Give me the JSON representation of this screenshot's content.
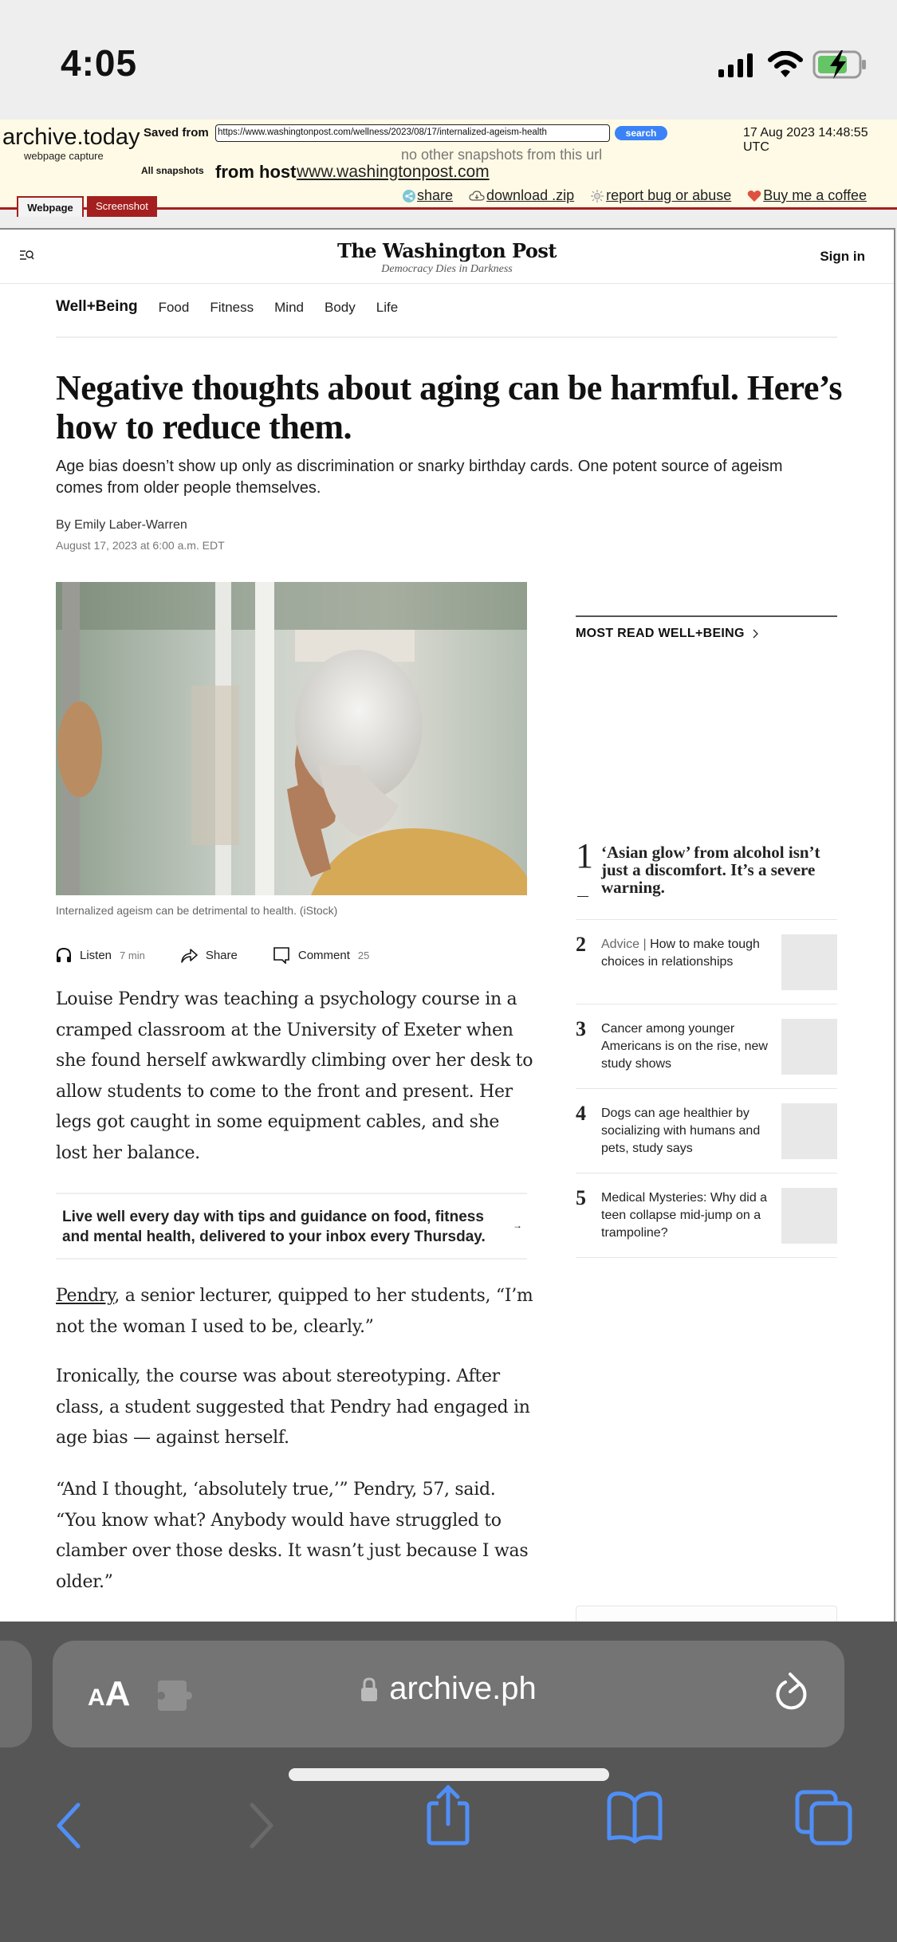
{
  "status_bar": {
    "time": "4:05",
    "icons": [
      "cellular-signal-icon",
      "wifi-icon",
      "battery-charging-icon"
    ],
    "battery_color": "#65c466"
  },
  "archive": {
    "logo": "archive.today",
    "subtitle": "webpage capture",
    "saved_from_label": "Saved from",
    "url_value": "https://www.washingtonpost.com/wellness/2023/08/17/internalized-ageism-health",
    "search_label": "search",
    "capture_date": "17 Aug 2023 14:48:55 UTC",
    "no_other": "no other snapshots from this url",
    "all_snapshots_label": "All snapshots",
    "from_host_label": "from host",
    "host": "www.washingtonpost.com",
    "tabs": [
      {
        "label": "Webpage",
        "active": true
      },
      {
        "label": "Screenshot",
        "active": false
      }
    ],
    "links": [
      {
        "icon": "share-icon",
        "label": "share"
      },
      {
        "icon": "cloud-download-icon",
        "label": "download .zip"
      },
      {
        "icon": "bug-icon",
        "label": "report bug or abuse"
      },
      {
        "icon": "heart-icon",
        "label": "Buy me a coffee"
      }
    ],
    "accent": "#a41f1f",
    "search_color": "#3b82f6"
  },
  "wp": {
    "logo": "The Washington Post",
    "tagline": "Democracy Dies in Darkness",
    "sign_in": "Sign in",
    "subnav": {
      "brand": "Well+Being",
      "items": [
        "Food",
        "Fitness",
        "Mind",
        "Body",
        "Life"
      ]
    }
  },
  "article": {
    "headline": "Negative thoughts about aging can be harmful. Here’s how to reduce them.",
    "dek": "Age bias doesn’t show up only as discrimination or snarky birthday cards. One potent source of ageism comes from older people themselves.",
    "byline": "By Emily Laber-Warren",
    "date": "August 17, 2023 at 6:00 a.m. EDT",
    "image_caption": "Internalized ageism can be detrimental to health. (iStock)",
    "actions": {
      "listen": "Listen",
      "listen_time": "7 min",
      "share": "Share",
      "comment": "Comment",
      "comment_count": "25"
    },
    "paragraphs": [
      "Louise Pendry was teaching a psychology course in a cramped classroom at the University of Exeter when she found herself awkwardly climbing over her desk to allow students to come to the front and present. Her legs got caught in some equipment cables, and she lost her balance.",
      "Ironically, the course was about stereotyping. After class, a student suggested that Pendry had engaged in age bias — against herself.",
      "“And I thought, ‘absolutely true,’” Pendry, 57, said. “You know what? Anybody would have struggled to clamber over those desks. It wasn’t just because I was older.”"
    ],
    "para2_link": "Pendry",
    "para2_rest": ", a senior lecturer, quipped to her students, “I’m not the woman I used to be, clearly.”",
    "newsletter": "Live well every day with tips and guidance on food, fitness and mental health, delivered to your inbox every Thursday."
  },
  "most_read": {
    "title": "MOST READ WELL+BEING",
    "items": [
      {
        "rank": "1",
        "kicker": "",
        "title": "‘Asian glow’ from alcohol isn’t just a discomfort. It’s a severe warning."
      },
      {
        "rank": "2",
        "kicker": "Advice | ",
        "title": "How to make tough choices in relationships"
      },
      {
        "rank": "3",
        "kicker": "",
        "title": "Cancer among younger Americans is on the rise, new study shows"
      },
      {
        "rank": "4",
        "kicker": "",
        "title": "Dogs can age healthier by socializing with humans and pets, study says"
      },
      {
        "rank": "5",
        "kicker": "",
        "title": "Medical Mysteries: Why did a teen collapse mid-jump on a trampoline?"
      }
    ]
  },
  "safari": {
    "aa_label": "AA",
    "url": "archive.ph",
    "toolbar": [
      "back-icon",
      "forward-icon",
      "share-icon",
      "bookmarks-icon",
      "tabs-icon"
    ],
    "accent": "#4f8ff7"
  }
}
